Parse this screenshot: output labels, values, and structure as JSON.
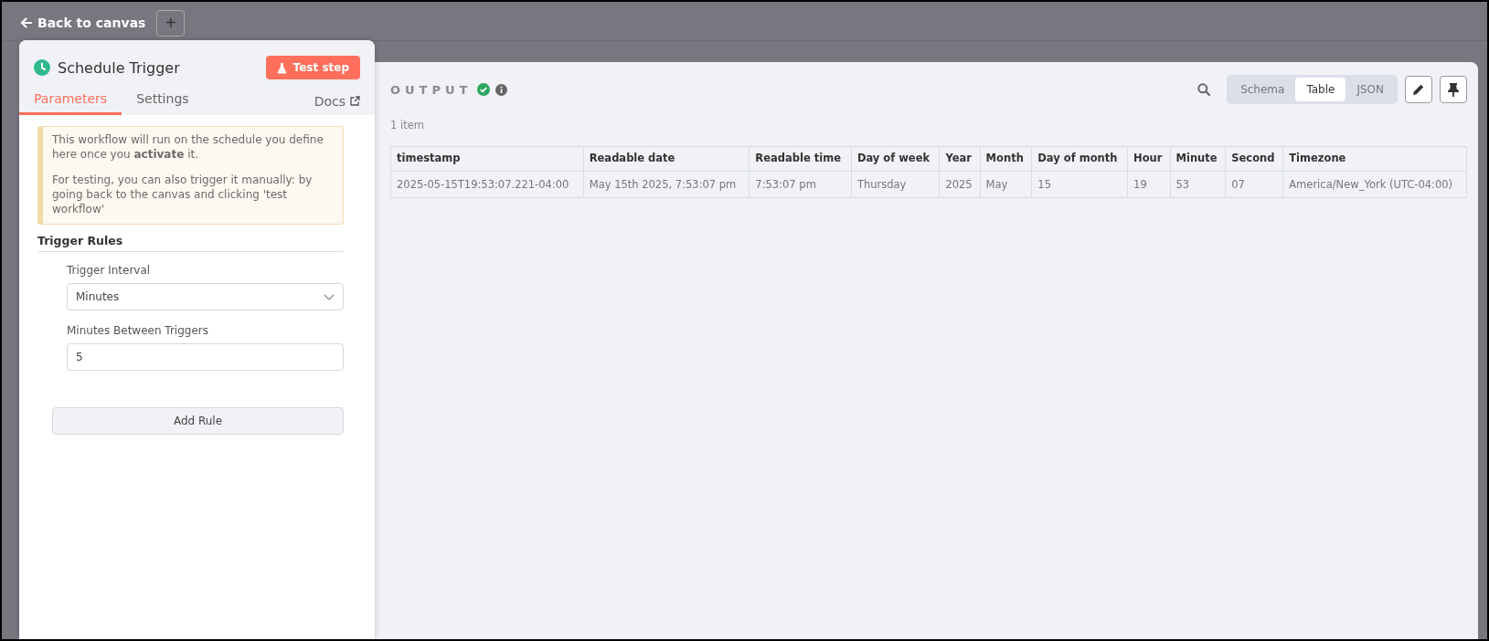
{
  "top_bar": {
    "back_link": "Back to canvas",
    "add_button": "+"
  },
  "node_panel": {
    "title": "Schedule Trigger",
    "test_button": "Test step",
    "tabs": [
      {
        "label": "Parameters",
        "selected": true
      },
      {
        "label": "Settings",
        "selected": false
      }
    ],
    "docs_link": "Docs",
    "notice": {
      "text": "This workflow will run on the schedule you define here once you **activate** it.",
      "text_2": "For testing, you can also trigger it manually: by going back to the canvas and clicking 'test workflow'"
    },
    "section_title": "Trigger Rules",
    "fields": [
      {
        "kind": "select",
        "label": "Trigger Interval",
        "value": "Minutes"
      },
      {
        "kind": "input",
        "label": "Minutes Between Triggers",
        "value": "5"
      }
    ],
    "add_rule_button": "Add Rule"
  },
  "output_panel": {
    "title": "OUTPUT",
    "view_tabs": [
      {
        "label": "Schema",
        "selected": false
      },
      {
        "label": "Table",
        "selected": true
      },
      {
        "label": "JSON",
        "selected": false
      }
    ],
    "item_count": "1 item",
    "table": {
      "columns": [
        "timestamp",
        "Readable date",
        "Readable time",
        "Day of week",
        "Year",
        "Month",
        "Day of month",
        "Hour",
        "Minute",
        "Second",
        "Timezone"
      ],
      "rows": [
        [
          "2025-05-15T19:53:07.221-04:00",
          "May 15th 2025, 7:53:07 pm",
          "7:53:07 pm",
          "Thursday",
          "2025",
          "May",
          "15",
          "19",
          "53",
          "07",
          "America/New_York (UTC-04:00)"
        ]
      ]
    }
  }
}
